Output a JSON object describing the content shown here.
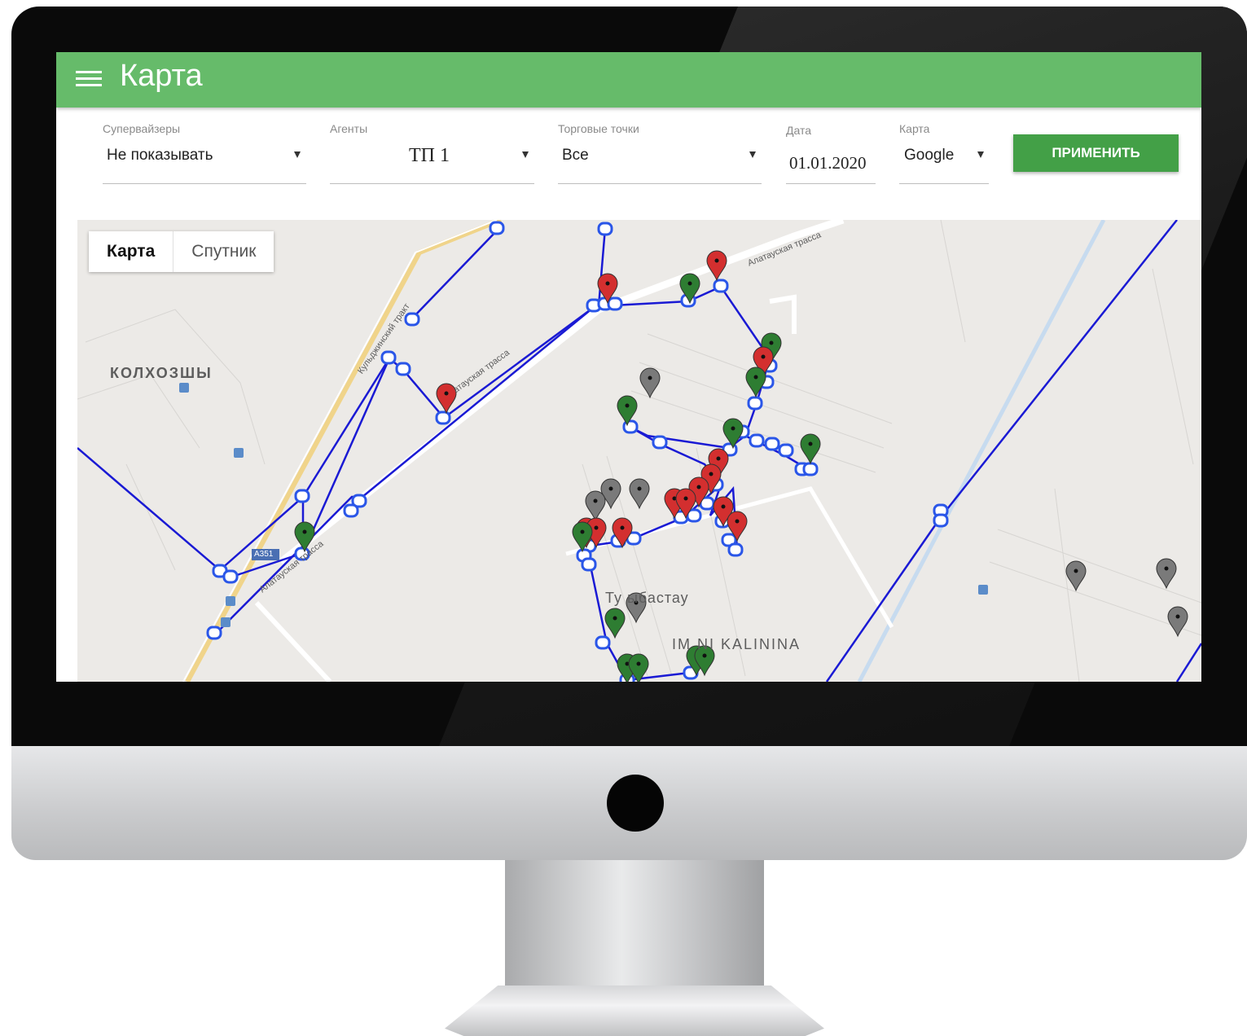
{
  "header": {
    "title": "Карта",
    "menu_icon": "hamburger-icon"
  },
  "filters": {
    "supervisors": {
      "label": "Супервайзеры",
      "value": "Не показывать"
    },
    "agents": {
      "label": "Агенты",
      "value": "ТП 1"
    },
    "outlets": {
      "label": "Торговые точки",
      "value": "Все"
    },
    "date": {
      "label": "Дата",
      "value": "01.01.2020"
    },
    "map_provider": {
      "label": "Карта",
      "value": "Google"
    },
    "apply_label": "ПРИМЕНИТЬ"
  },
  "map": {
    "toggle": {
      "map_label": "Карта",
      "satellite_label": "Спутник"
    },
    "place_labels": {
      "kolkhozshy": "КОЛХОЗШЫ",
      "turgen": "Ту ыбастау",
      "kalinina": "IM NI KALININA",
      "road_1": "Алатауская трасса",
      "road_2": "атауская трасса",
      "road_3": "Кульджинский тракт",
      "road_4": "Алатауская трасса",
      "road_shield": "А351"
    },
    "marker_colors": {
      "red": "#d32f2f",
      "green": "#2e7d32",
      "gray": "#7a7a7a",
      "route": "#1a1ad4",
      "stop": "#2a56e8"
    }
  },
  "colors": {
    "accent": "#66bb6a",
    "button": "#43a047"
  }
}
